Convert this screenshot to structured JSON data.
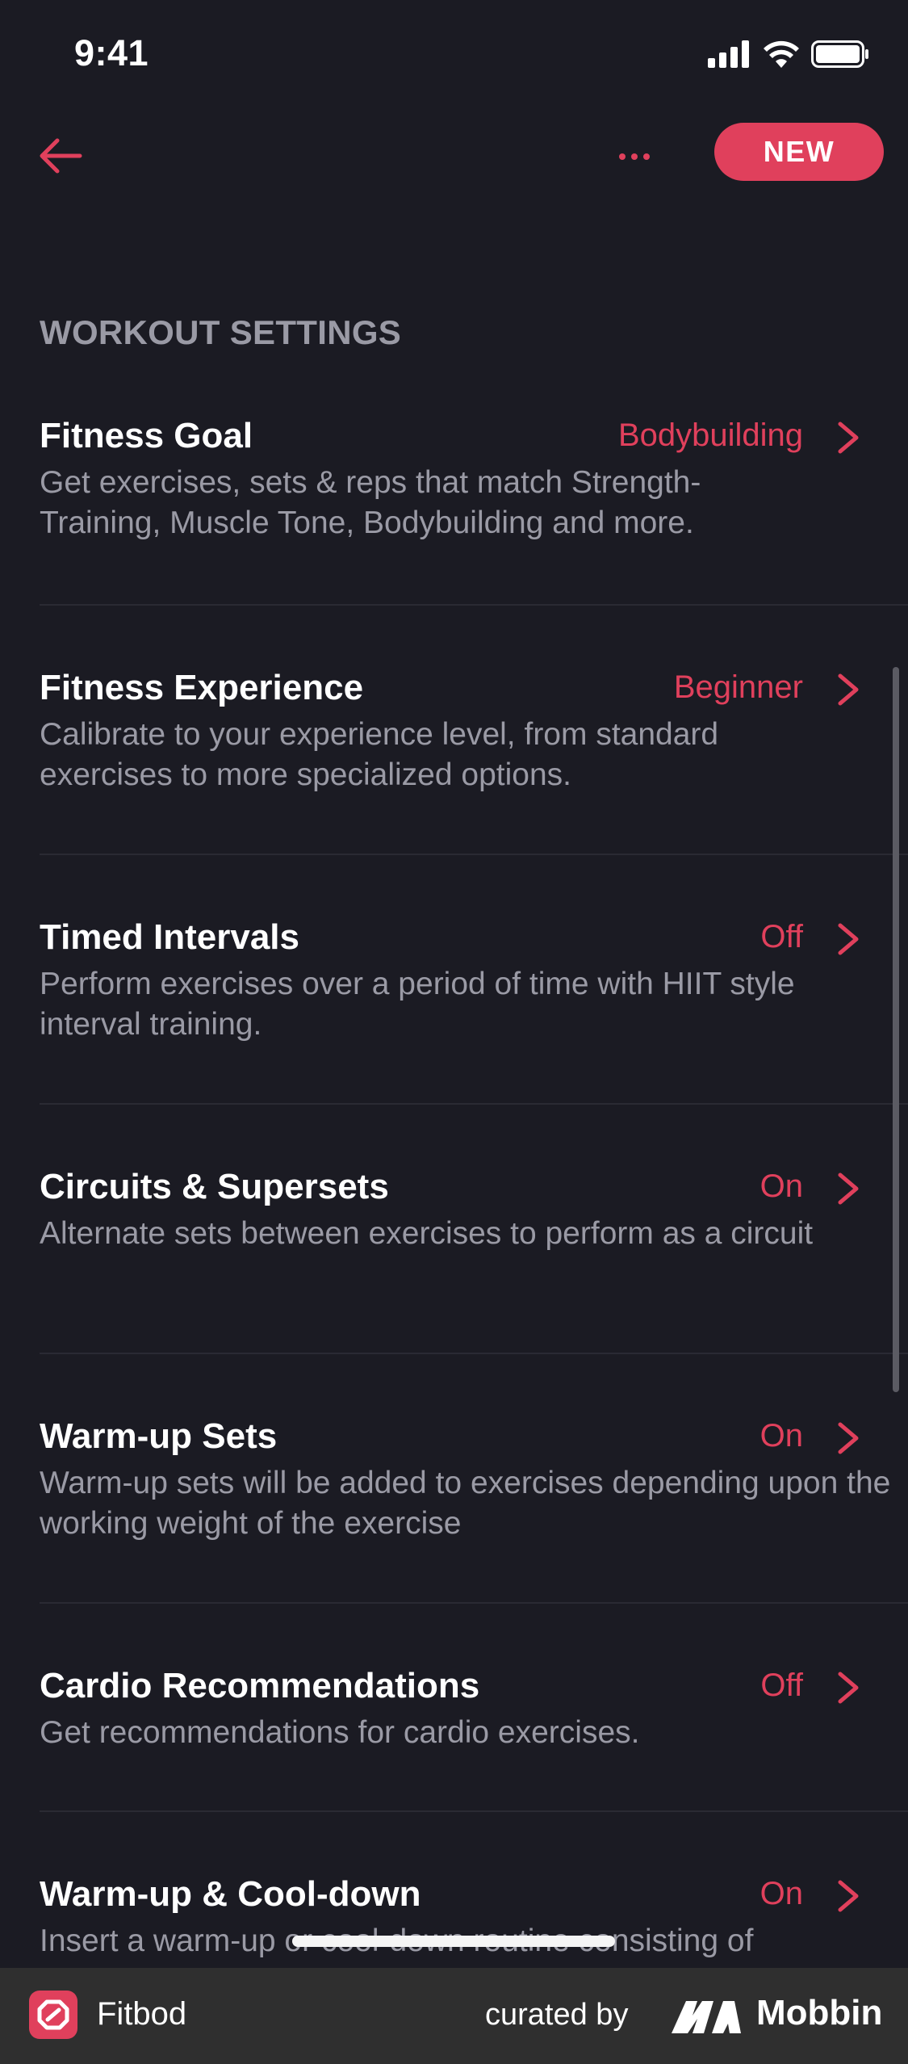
{
  "status_bar": {
    "time": "9:41"
  },
  "nav": {
    "back_icon": "arrow-left-icon",
    "more_icon": "ellipsis-icon",
    "new_label": "NEW"
  },
  "section": {
    "title": "WORKOUT SETTINGS"
  },
  "settings": [
    {
      "title": "Fitness Goal",
      "value": "Bodybuilding",
      "description": "Get exercises, sets & reps that match Strength-Training, Muscle Tone, Bodybuilding and more."
    },
    {
      "title": "Fitness Experience",
      "value": "Beginner",
      "description": "Calibrate to your experience level, from standard exercises to more specialized options."
    },
    {
      "title": "Timed Intervals",
      "value": "Off",
      "description": "Perform exercises over a period of time with HIIT style interval training."
    },
    {
      "title": "Circuits & Supersets",
      "value": "On",
      "description": "Alternate sets between exercises to perform as a circuit"
    },
    {
      "title": "Warm-up Sets",
      "value": "On",
      "description": "Warm-up sets will be added to exercises depending upon the working weight of the exercise"
    },
    {
      "title": "Cardio Recommendations",
      "value": "Off",
      "description": "Get recommendations for cardio exercises."
    },
    {
      "title": "Warm-up & Cool-down",
      "value": "On",
      "description": "Insert a warm-up or cool-down routine consisting of"
    }
  ],
  "footer": {
    "app_name": "Fitbod",
    "curated_by": "curated by",
    "brand": "Mobbin"
  },
  "colors": {
    "background": "#1b1b23",
    "accent": "#e0405c",
    "secondary_text": "#9a9aa5",
    "footer": "#2f2f2f"
  }
}
